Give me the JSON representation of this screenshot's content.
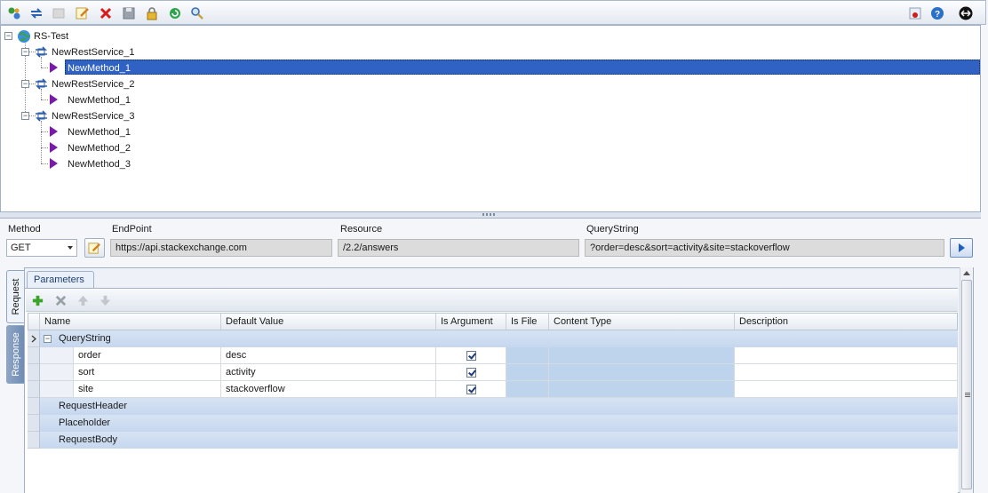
{
  "toolbar": {
    "left_icons": [
      "new-project-icon",
      "refresh-services-icon",
      "disabled-icon",
      "edit-icon",
      "delete-icon",
      "save-icon",
      "lock-icon",
      "reload-icon",
      "search-icon"
    ],
    "right_icons": [
      "record-icon",
      "help-icon",
      "swap-icon"
    ]
  },
  "tree": {
    "root": "RS-Test",
    "services": [
      {
        "name": "NewRestService_1",
        "methods": [
          "NewMethod_1"
        ]
      },
      {
        "name": "NewRestService_2",
        "methods": [
          "NewMethod_1"
        ]
      },
      {
        "name": "NewRestService_3",
        "methods": [
          "NewMethod_1",
          "NewMethod_2",
          "NewMethod_3"
        ]
      }
    ]
  },
  "request": {
    "method_label": "Method",
    "method_value": "GET",
    "endpoint_label": "EndPoint",
    "endpoint_value": "https://api.stackexchange.com",
    "resource_label": "Resource",
    "resource_value": "/2.2/answers",
    "querystring_label": "QueryString",
    "querystring_value": "?order=desc&sort=activity&site=stackoverflow"
  },
  "side_tabs": {
    "request": "Request",
    "response": "Response"
  },
  "params": {
    "tab_label": "Parameters",
    "columns": [
      "Name",
      "Default Value",
      "Is Argument",
      "Is File",
      "Content Type",
      "Description"
    ],
    "group_querystring": "QueryString",
    "rows": [
      {
        "name": "order",
        "default": "desc",
        "is_argument": true
      },
      {
        "name": "sort",
        "default": "activity",
        "is_argument": true
      },
      {
        "name": "site",
        "default": "stackoverflow",
        "is_argument": true
      }
    ],
    "groups_other": [
      "RequestHeader",
      "Placeholder",
      "RequestBody"
    ]
  },
  "colors": {
    "selection": "#2f62c3",
    "method_arrow": "#7a1aa8",
    "group_row": "#c6d7ee"
  }
}
